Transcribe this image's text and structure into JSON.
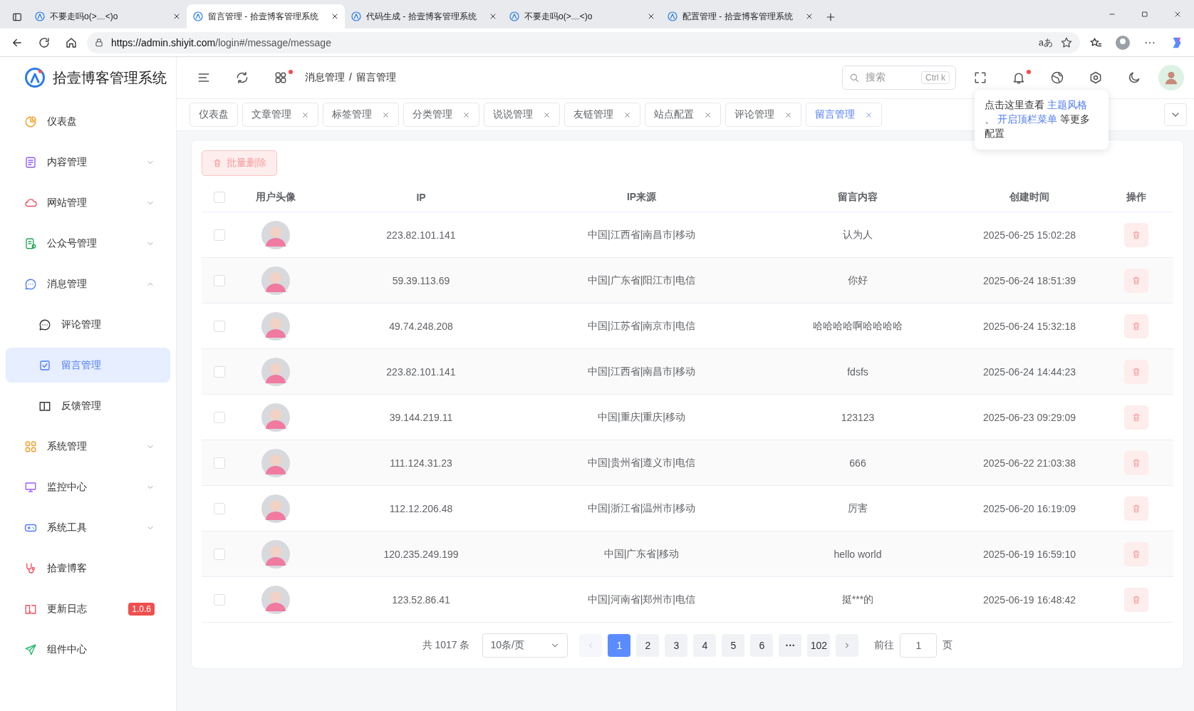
{
  "browser": {
    "tabs": [
      {
        "title": "不要走吗o(>﹏<)o",
        "selected": false
      },
      {
        "title": "留言管理 - 拾壹博客管理系统",
        "selected": true
      },
      {
        "title": "代码生成 - 拾壹博客管理系统",
        "selected": false
      },
      {
        "title": "不要走吗o(>﹏<)o",
        "selected": false
      },
      {
        "title": "配置管理 - 拾壹博客管理系统",
        "selected": false
      }
    ],
    "url_host": "https://admin.shiyit.com",
    "url_path": "/login#/message/message",
    "read_aloud": "aあ",
    "more": "···"
  },
  "sidebar": {
    "title": "拾壹博客管理系统",
    "items": [
      {
        "label": "仪表盘",
        "expandable": false
      },
      {
        "label": "内容管理",
        "expandable": true,
        "expanded": false
      },
      {
        "label": "网站管理",
        "expandable": true,
        "expanded": false
      },
      {
        "label": "公众号管理",
        "expandable": true,
        "expanded": false
      },
      {
        "label": "消息管理",
        "expandable": true,
        "expanded": true,
        "children": [
          {
            "label": "评论管理",
            "selected": false
          },
          {
            "label": "留言管理",
            "selected": true
          },
          {
            "label": "反馈管理",
            "selected": false
          }
        ]
      },
      {
        "label": "系统管理",
        "expandable": true,
        "expanded": false
      },
      {
        "label": "监控中心",
        "expandable": true,
        "expanded": false
      },
      {
        "label": "系统工具",
        "expandable": true,
        "expanded": false
      },
      {
        "label": "拾壹博客",
        "expandable": false
      },
      {
        "label": "更新日志",
        "expandable": false,
        "badge": "1.0.6"
      },
      {
        "label": "组件中心",
        "expandable": false
      }
    ]
  },
  "header": {
    "breadcrumb": [
      "消息管理",
      "留言管理"
    ],
    "breadcrumb_separator": "/",
    "search": {
      "placeholder": "搜索",
      "shortcut": "Ctrl k"
    }
  },
  "page_tabs": [
    {
      "label": "仪表盘",
      "closable": false,
      "selected": false
    },
    {
      "label": "文章管理",
      "closable": true,
      "selected": false
    },
    {
      "label": "标签管理",
      "closable": true,
      "selected": false
    },
    {
      "label": "分类管理",
      "closable": true,
      "selected": false
    },
    {
      "label": "说说管理",
      "closable": true,
      "selected": false
    },
    {
      "label": "友链管理",
      "closable": true,
      "selected": false
    },
    {
      "label": "站点配置",
      "closable": true,
      "selected": false
    },
    {
      "label": "评论管理",
      "closable": true,
      "selected": false
    },
    {
      "label": "留言管理",
      "closable": true,
      "selected": true
    }
  ],
  "tooltip": {
    "before": "点击这里查看",
    "link1": "主题风格",
    "mid": "、",
    "link2": "开启顶栏菜单",
    "after": "等更多配置"
  },
  "toolbar": {
    "batch_delete": {
      "label": "批量删除",
      "disabled": true
    }
  },
  "table": {
    "header_checked": false,
    "columns": [
      "用户头像",
      "IP",
      "IP来源",
      "留言内容",
      "创建时间",
      "操作"
    ],
    "rows": [
      {
        "checked": false,
        "ip": "223.82.101.141",
        "source": "中国|江西省|南昌市|移动",
        "content": "认为人",
        "time": "2025-06-25 15:02:28"
      },
      {
        "checked": false,
        "ip": "59.39.113.69",
        "source": "中国|广东省|阳江市|电信",
        "content": "你好",
        "time": "2025-06-24 18:51:39"
      },
      {
        "checked": false,
        "ip": "49.74.248.208",
        "source": "中国|江苏省|南京市|电信",
        "content": "哈哈哈哈啊哈哈哈哈",
        "time": "2025-06-24 15:32:18"
      },
      {
        "checked": false,
        "ip": "223.82.101.141",
        "source": "中国|江西省|南昌市|移动",
        "content": "fdsfs",
        "time": "2025-06-24 14:44:23"
      },
      {
        "checked": false,
        "ip": "39.144.219.11",
        "source": "中国|重庆|重庆|移动",
        "content": "123123",
        "time": "2025-06-23 09:29:09"
      },
      {
        "checked": false,
        "ip": "111.124.31.23",
        "source": "中国|贵州省|遵义市|电信",
        "content": "666",
        "time": "2025-06-22 21:03:38"
      },
      {
        "checked": false,
        "ip": "112.12.206.48",
        "source": "中国|浙江省|温州市|移动",
        "content": "厉害",
        "time": "2025-06-20 16:19:09"
      },
      {
        "checked": false,
        "ip": "120.235.249.199",
        "source": "中国|广东省|移动",
        "content": "hello world",
        "time": "2025-06-19 16:59:10"
      },
      {
        "checked": false,
        "ip": "123.52.86.41",
        "source": "中国|河南省|郑州市|电信",
        "content": "挺***的",
        "time": "2025-06-19 16:48:42"
      }
    ]
  },
  "pagination": {
    "total": "共 1017 条",
    "page_size": "10条/页",
    "prev_disabled": true,
    "pages": [
      {
        "label": "1",
        "selected": true,
        "kind": "page"
      },
      {
        "label": "2",
        "selected": false,
        "kind": "page"
      },
      {
        "label": "3",
        "selected": false,
        "kind": "page"
      },
      {
        "label": "4",
        "selected": false,
        "kind": "page"
      },
      {
        "label": "5",
        "selected": false,
        "kind": "page"
      },
      {
        "label": "6",
        "selected": false,
        "kind": "page"
      },
      {
        "label": "···",
        "selected": false,
        "kind": "more"
      },
      {
        "label": "102",
        "selected": false,
        "kind": "page"
      }
    ],
    "goto_label": "前往",
    "goto_value": "1",
    "goto_suffix": "页"
  }
}
